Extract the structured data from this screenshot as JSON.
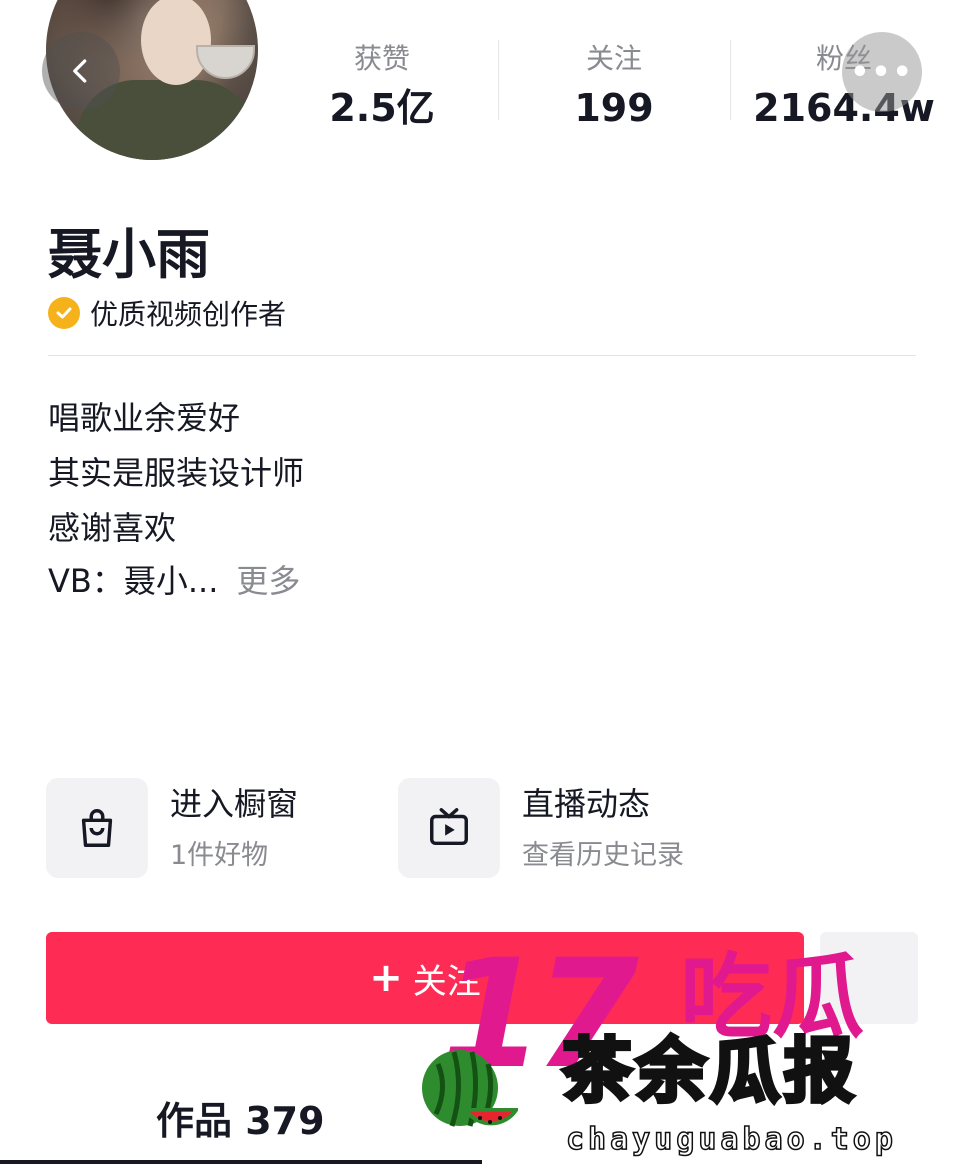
{
  "stats": {
    "likes": {
      "label": "获赞",
      "value": "2.5亿"
    },
    "following": {
      "label": "关注",
      "value": "199"
    },
    "fans": {
      "label": "粉丝",
      "value": "2164.4w"
    }
  },
  "profile": {
    "name": "聂小雨",
    "badge": "优质视频创作者",
    "bio": [
      "唱歌业余爱好",
      "其实是服装设计师",
      "感谢喜欢",
      "VB：聂小..."
    ],
    "bio_more": "更多"
  },
  "features": {
    "shop": {
      "title": "进入橱窗",
      "subtitle": "1件好物",
      "icon": "shopping-bag-icon"
    },
    "live": {
      "title": "直播动态",
      "subtitle": "查看历史记录",
      "icon": "tv-play-icon"
    }
  },
  "follow_button": {
    "plus": "+",
    "label": "关注"
  },
  "tabs": {
    "works": "作品 379"
  },
  "watermark": {
    "number": "17",
    "eat": "吃瓜",
    "main": "茶余瓜报",
    "url": "chayuguabao.top",
    "icon": "watermelon-icon"
  },
  "colors": {
    "accent": "#fe2c55",
    "badge": "#f5b21b",
    "watermark_pink": "#e0198f",
    "watermark_yellow": "#ffec00"
  }
}
